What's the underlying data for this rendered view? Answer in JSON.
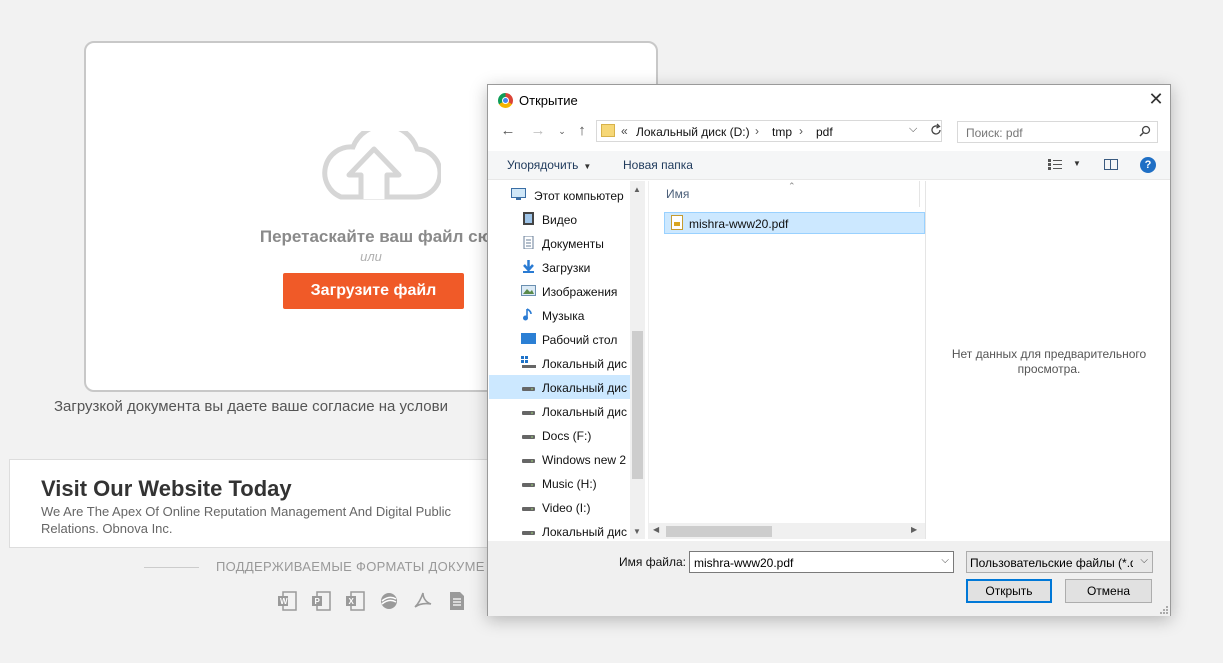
{
  "page": {
    "drop_title": "Перетаскайте ваш файл сюда",
    "drop_or": "или",
    "upload_button": "Загрузите файл",
    "consent_text": "Загрузкой документа вы даете ваше согласие на услови",
    "ad": {
      "title": "Visit Our Website Today",
      "text": "We Are The Apex Of Online Reputation Management And Digital Public Relations. Obnova Inc."
    },
    "formats_label": "ПОДДЕРЖИВАЕМЫЕ ФОРМАТЫ ДОКУМЕ",
    "format_icons": [
      "word-icon",
      "powerpoint-icon",
      "excel-icon",
      "openoffice-icon",
      "pdf-icon",
      "text-file-icon"
    ]
  },
  "dialog": {
    "title": "Открытие",
    "address": {
      "overflow": "«",
      "crumbs": [
        "Локальный диск (D:)",
        "tmp",
        "pdf"
      ]
    },
    "search_placeholder": "Поиск: pdf",
    "toolbar": {
      "organize": "Упорядочить",
      "new_folder": "Новая папка"
    },
    "nav_items": [
      {
        "label": "Этот компьютер",
        "icon": "computer-icon"
      },
      {
        "label": "Видео",
        "icon": "video-folder-icon"
      },
      {
        "label": "Документы",
        "icon": "documents-folder-icon"
      },
      {
        "label": "Загрузки",
        "icon": "downloads-folder-icon"
      },
      {
        "label": "Изображения",
        "icon": "pictures-folder-icon"
      },
      {
        "label": "Музыка",
        "icon": "music-folder-icon"
      },
      {
        "label": "Рабочий стол",
        "icon": "desktop-folder-icon"
      },
      {
        "label": "Локальный дис",
        "icon": "windows-drive-icon"
      },
      {
        "label": "Локальный дис",
        "icon": "drive-icon",
        "selected": true
      },
      {
        "label": "Локальный дис",
        "icon": "drive-icon"
      },
      {
        "label": "Docs (F:)",
        "icon": "drive-icon"
      },
      {
        "label": "Windows new 2",
        "icon": "drive-icon"
      },
      {
        "label": "Music (H:)",
        "icon": "drive-icon"
      },
      {
        "label": "Video (I:)",
        "icon": "drive-icon"
      },
      {
        "label": "Локальный дис",
        "icon": "drive-icon"
      }
    ],
    "column_name": "Имя",
    "files": [
      {
        "name": "mishra-www20.pdf",
        "selected": true
      }
    ],
    "preview_text": "Нет данных для предварительного просмотра.",
    "filename_label": "Имя файла:",
    "filename_value": "mishra-www20.pdf",
    "filetype_value": "Пользовательские файлы (*.d",
    "open_button": "Открыть",
    "cancel_button": "Отмена"
  },
  "colors": {
    "accent_button": "#f05a28",
    "selection": "#cce8ff",
    "focus_border": "#0078d7"
  }
}
